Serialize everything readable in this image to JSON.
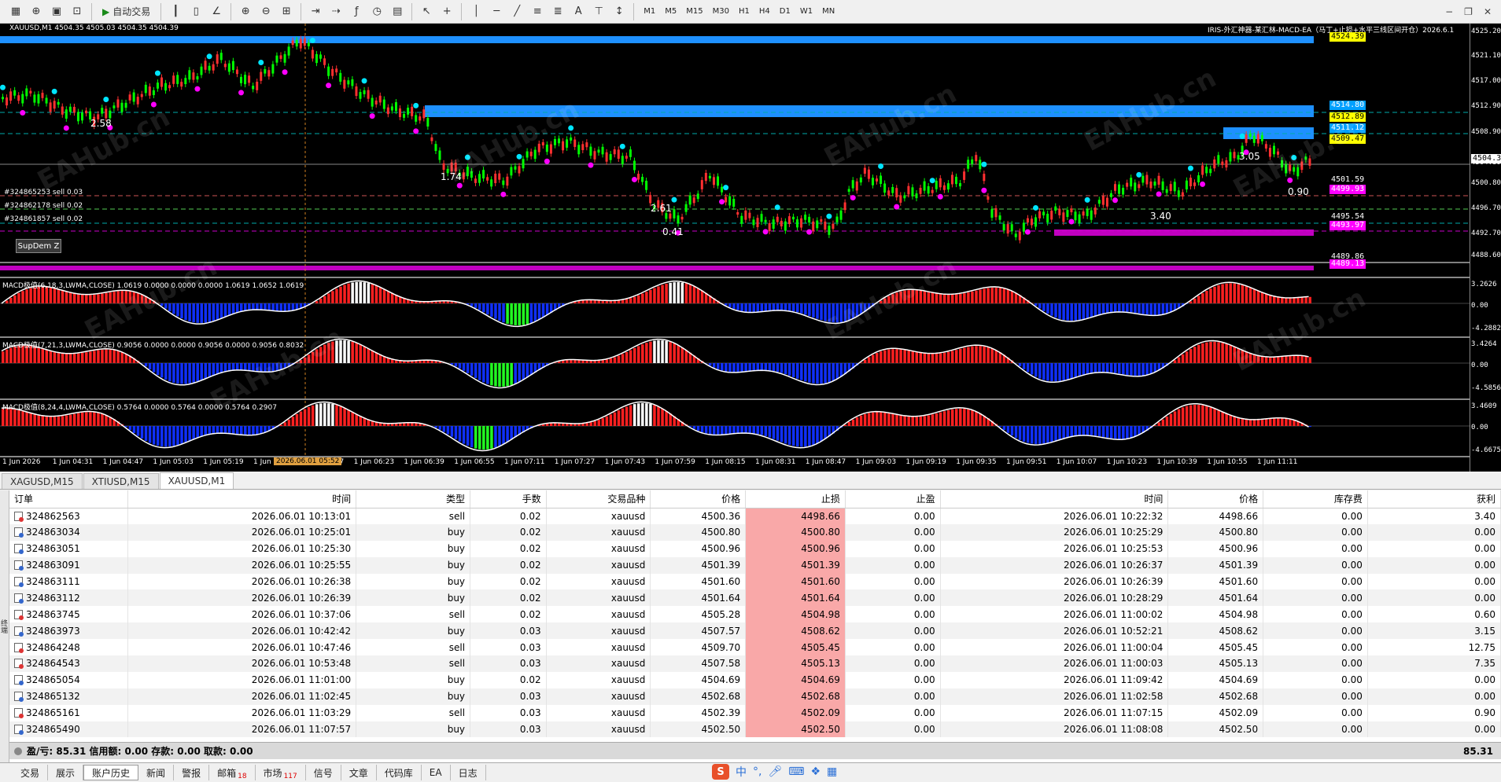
{
  "toolbar": {
    "auto_trade_label": "自动交易",
    "timeframes": [
      "M1",
      "M5",
      "M15",
      "M30",
      "H1",
      "H4",
      "D1",
      "W1",
      "MN"
    ]
  },
  "chart": {
    "symbol_info": "XAUUSD,M1  4504.35 4505.03 4504.35 4504.39",
    "ea_info": "IRIS-外汇神器-某汇林-MACD-EA（马丁+止损+水平三线区间开仓）2026.6.1",
    "supdem_button": "SupDem Z",
    "order_labels": [
      "#324865253 sell 0.03",
      "#324862178 sell 0.02",
      "#324861857 sell 0.02"
    ],
    "price_axis": [
      "4525.20",
      "4521.10",
      "4517.00",
      "4512.90",
      "4508.90",
      "4504.39",
      "4500.80",
      "4496.70",
      "4492.70",
      "4488.60"
    ],
    "price_tags": [
      {
        "text": "4524.39",
        "bg": "#ffff00",
        "fg": "#000"
      },
      {
        "text": "4514.80",
        "bg": "#00a0ff",
        "fg": "#fff"
      },
      {
        "text": "4512.89",
        "bg": "#ffff00",
        "fg": "#000"
      },
      {
        "text": "4511.12",
        "bg": "#00a0ff",
        "fg": "#fff"
      },
      {
        "text": "4509.47",
        "bg": "#ffff00",
        "fg": "#000"
      },
      {
        "text": "4504.39",
        "bg": "#ffffff",
        "fg": "#000"
      },
      {
        "text": "4501.59",
        "bg": "#000000",
        "fg": "#fff"
      },
      {
        "text": "4499.93",
        "bg": "#ff00ff",
        "fg": "#fff"
      },
      {
        "text": "4495.54",
        "bg": "#000000",
        "fg": "#fff"
      },
      {
        "text": "4493.97",
        "bg": "#ff00ff",
        "fg": "#fff"
      },
      {
        "text": "4489.86",
        "bg": "#000000",
        "fg": "#fff"
      },
      {
        "text": "4489.13",
        "bg": "#ff00ff",
        "fg": "#fff"
      }
    ],
    "chart_texts": [
      "2.58",
      "1.74",
      "2.61",
      "0.41",
      "3.40",
      "3.05",
      "0.90"
    ],
    "macd1": {
      "title": "MACD极值(6,18,3,LWMA,CLOSE) 1.0619 0.0000 0.0000 0.0000 1.0619 1.0652 1.0619",
      "axis": [
        "3.2626",
        "0.00",
        "-4.2882"
      ]
    },
    "macd2": {
      "title": "MACD极值(7,21,3,LWMA,CLOSE) 0.9056 0.0000 0.0000 0.9056 0.0000 0.9056 0.8032",
      "axis": [
        "3.4264",
        "0.00",
        "-4.5856"
      ]
    },
    "macd3": {
      "title": "MACD极值(8,24,4,LWMA,CLOSE) 0.5764 0.0000 0.5764 0.0000 0.5764 0.2907",
      "axis": [
        "3.4609",
        "0.00",
        "-4.6675"
      ]
    },
    "time_axis": [
      "1 Jun 2026",
      "1 Jun 04:31",
      "1 Jun 04:47",
      "1 Jun 05:03",
      "1 Jun 05:19",
      "1 Jun 0",
      "1 Jun 06:07",
      "1 Jun 06:23",
      "1 Jun 06:39",
      "1 Jun 06:55",
      "1 Jun 07:11",
      "1 Jun 07:27",
      "1 Jun 07:43",
      "1 Jun 07:59",
      "1 Jun 08:15",
      "1 Jun 08:31",
      "1 Jun 08:47",
      "1 Jun 09:03",
      "1 Jun 09:19",
      "1 Jun 09:35",
      "1 Jun 09:51",
      "1 Jun 10:07",
      "1 Jun 10:23",
      "1 Jun 10:39",
      "1 Jun 10:55",
      "1 Jun 11:11"
    ],
    "crosshair_time": "2026.06.01 05:52",
    "watermark": "EAHub.cn"
  },
  "symbol_tabs": [
    "XAGUSD,M15",
    "XTIUSD,M15",
    "XAUUSD,M1"
  ],
  "table": {
    "headers": [
      "订单",
      "时间",
      "类型",
      "手数",
      "交易品种",
      "价格",
      "止损",
      "止盈",
      "时间",
      "价格",
      "库存费",
      "获利"
    ],
    "rows": [
      [
        "324862563",
        "2026.06.01 10:13:01",
        "sell",
        "0.02",
        "xauusd",
        "4500.36",
        "4498.66",
        "0.00",
        "2026.06.01 10:22:32",
        "4498.66",
        "0.00",
        "3.40"
      ],
      [
        "324863034",
        "2026.06.01 10:25:01",
        "buy",
        "0.02",
        "xauusd",
        "4500.80",
        "4500.80",
        "0.00",
        "2026.06.01 10:25:29",
        "4500.80",
        "0.00",
        "0.00"
      ],
      [
        "324863051",
        "2026.06.01 10:25:30",
        "buy",
        "0.02",
        "xauusd",
        "4500.96",
        "4500.96",
        "0.00",
        "2026.06.01 10:25:53",
        "4500.96",
        "0.00",
        "0.00"
      ],
      [
        "324863091",
        "2026.06.01 10:25:55",
        "buy",
        "0.02",
        "xauusd",
        "4501.39",
        "4501.39",
        "0.00",
        "2026.06.01 10:26:37",
        "4501.39",
        "0.00",
        "0.00"
      ],
      [
        "324863111",
        "2026.06.01 10:26:38",
        "buy",
        "0.02",
        "xauusd",
        "4501.60",
        "4501.60",
        "0.00",
        "2026.06.01 10:26:39",
        "4501.60",
        "0.00",
        "0.00"
      ],
      [
        "324863112",
        "2026.06.01 10:26:39",
        "buy",
        "0.02",
        "xauusd",
        "4501.64",
        "4501.64",
        "0.00",
        "2026.06.01 10:28:29",
        "4501.64",
        "0.00",
        "0.00"
      ],
      [
        "324863745",
        "2026.06.01 10:37:06",
        "sell",
        "0.02",
        "xauusd",
        "4505.28",
        "4504.98",
        "0.00",
        "2026.06.01 11:00:02",
        "4504.98",
        "0.00",
        "0.60"
      ],
      [
        "324863973",
        "2026.06.01 10:42:42",
        "buy",
        "0.03",
        "xauusd",
        "4507.57",
        "4508.62",
        "0.00",
        "2026.06.01 10:52:21",
        "4508.62",
        "0.00",
        "3.15"
      ],
      [
        "324864248",
        "2026.06.01 10:47:46",
        "sell",
        "0.03",
        "xauusd",
        "4509.70",
        "4505.45",
        "0.00",
        "2026.06.01 11:00:04",
        "4505.45",
        "0.00",
        "12.75"
      ],
      [
        "324864543",
        "2026.06.01 10:53:48",
        "sell",
        "0.03",
        "xauusd",
        "4507.58",
        "4505.13",
        "0.00",
        "2026.06.01 11:00:03",
        "4505.13",
        "0.00",
        "7.35"
      ],
      [
        "324865054",
        "2026.06.01 11:01:00",
        "buy",
        "0.02",
        "xauusd",
        "4504.69",
        "4504.69",
        "0.00",
        "2026.06.01 11:09:42",
        "4504.69",
        "0.00",
        "0.00"
      ],
      [
        "324865132",
        "2026.06.01 11:02:45",
        "buy",
        "0.03",
        "xauusd",
        "4502.68",
        "4502.68",
        "0.00",
        "2026.06.01 11:02:58",
        "4502.68",
        "0.00",
        "0.00"
      ],
      [
        "324865161",
        "2026.06.01 11:03:29",
        "sell",
        "0.03",
        "xauusd",
        "4502.39",
        "4502.09",
        "0.00",
        "2026.06.01 11:07:15",
        "4502.09",
        "0.00",
        "0.90"
      ],
      [
        "324865490",
        "2026.06.01 11:07:57",
        "buy",
        "0.03",
        "xauusd",
        "4502.50",
        "4502.50",
        "0.00",
        "2026.06.01 11:08:08",
        "4502.50",
        "0.00",
        "0.00"
      ]
    ],
    "summary": "盈/亏: 85.31  信用额: 0.00  存款: 0.00  取款: 0.00",
    "total": "85.31"
  },
  "bottom_tabs": [
    {
      "label": "交易",
      "badge": ""
    },
    {
      "label": "展示",
      "badge": ""
    },
    {
      "label": "账户历史",
      "badge": ""
    },
    {
      "label": "新闻",
      "badge": ""
    },
    {
      "label": "警报",
      "badge": ""
    },
    {
      "label": "邮箱",
      "badge": "18"
    },
    {
      "label": "市场",
      "badge": "117"
    },
    {
      "label": "信号",
      "badge": ""
    },
    {
      "label": "文章",
      "badge": ""
    },
    {
      "label": "代码库",
      "badge": ""
    },
    {
      "label": "EA",
      "badge": ""
    },
    {
      "label": "日志",
      "badge": ""
    }
  ],
  "side_label": "终端",
  "ime": {
    "logo": "S",
    "lang": "中"
  },
  "colors": {
    "bull": "#00ff00",
    "bear": "#ff3030",
    "macd_pos": "#ff2020",
    "macd_neg": "#1030ff",
    "zone_blue": "#1e90ff",
    "zone_magenta": "#c000c0"
  }
}
